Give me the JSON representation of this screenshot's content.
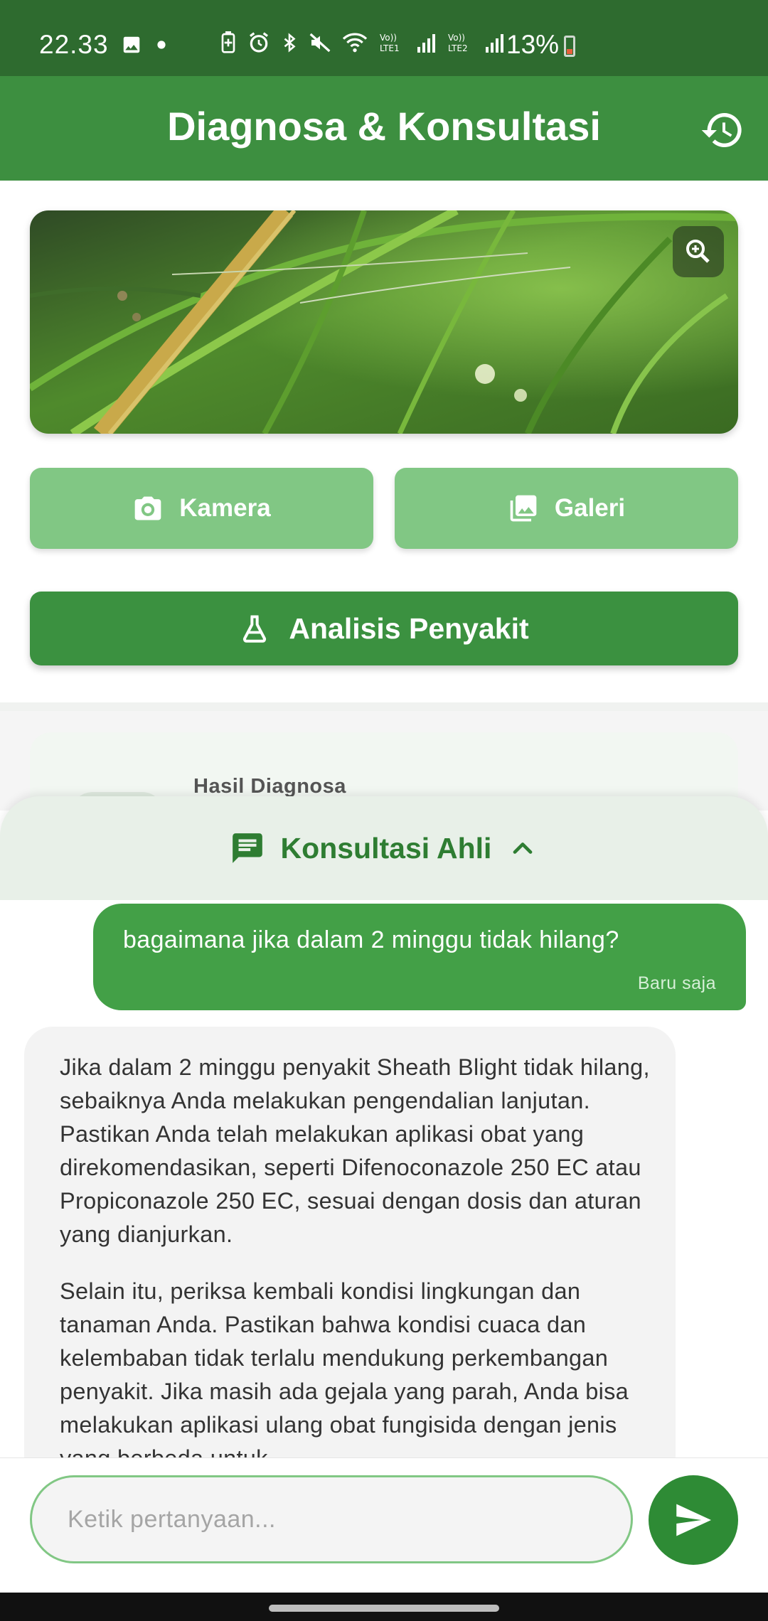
{
  "status_bar": {
    "time": "22.33",
    "battery": "13%",
    "icons": [
      "image-icon",
      "dot-icon",
      "battery-saver-icon",
      "alarm-icon",
      "bluetooth-icon",
      "mute-icon",
      "wifi-icon",
      "volte-lte1-icon",
      "signal-icon",
      "volte-lte2-icon",
      "signal-icon"
    ]
  },
  "app_bar": {
    "title": "Diagnosa & Konsultasi",
    "history_icon": "history-icon"
  },
  "preview": {
    "zoom_icon": "zoom-in-icon"
  },
  "actions": {
    "camera_label": "Kamera",
    "gallery_label": "Galeri",
    "analyze_label": "Analisis Penyakit"
  },
  "result": {
    "label": "Hasil Diagnosa"
  },
  "consultation": {
    "title": "Konsultasi Ahli",
    "messages": [
      {
        "role": "user",
        "text": "bagaimana jika dalam 2 minggu tidak hilang?",
        "time": "Baru saja"
      },
      {
        "role": "expert",
        "paragraphs": [
          "Jika dalam 2 minggu penyakit Sheath Blight tidak hilang, sebaiknya Anda melakukan pengendalian lanjutan. Pastikan Anda telah melakukan aplikasi obat yang direkomendasikan, seperti Difenoconazole 250 EC atau Propiconazole 250 EC, sesuai dengan dosis dan aturan yang dianjurkan.",
          "Selain itu, periksa kembali kondisi lingkungan dan tanaman Anda. Pastikan bahwa kondisi cuaca dan kelembaban tidak terlalu mendukung perkembangan penyakit. Jika masih ada gejala yang parah, Anda bisa melakukan aplikasi ulang obat fungisida dengan jenis yang berbeda untuk"
        ]
      }
    ]
  },
  "input": {
    "placeholder": "Ketik pertanyaan...",
    "value": ""
  },
  "colors": {
    "status_bar": "#2e6b2f",
    "primary": "#3d8f40",
    "light_button": "#81c784",
    "user_bubble": "#43a047",
    "sheet_header": "#e8f0e8"
  }
}
